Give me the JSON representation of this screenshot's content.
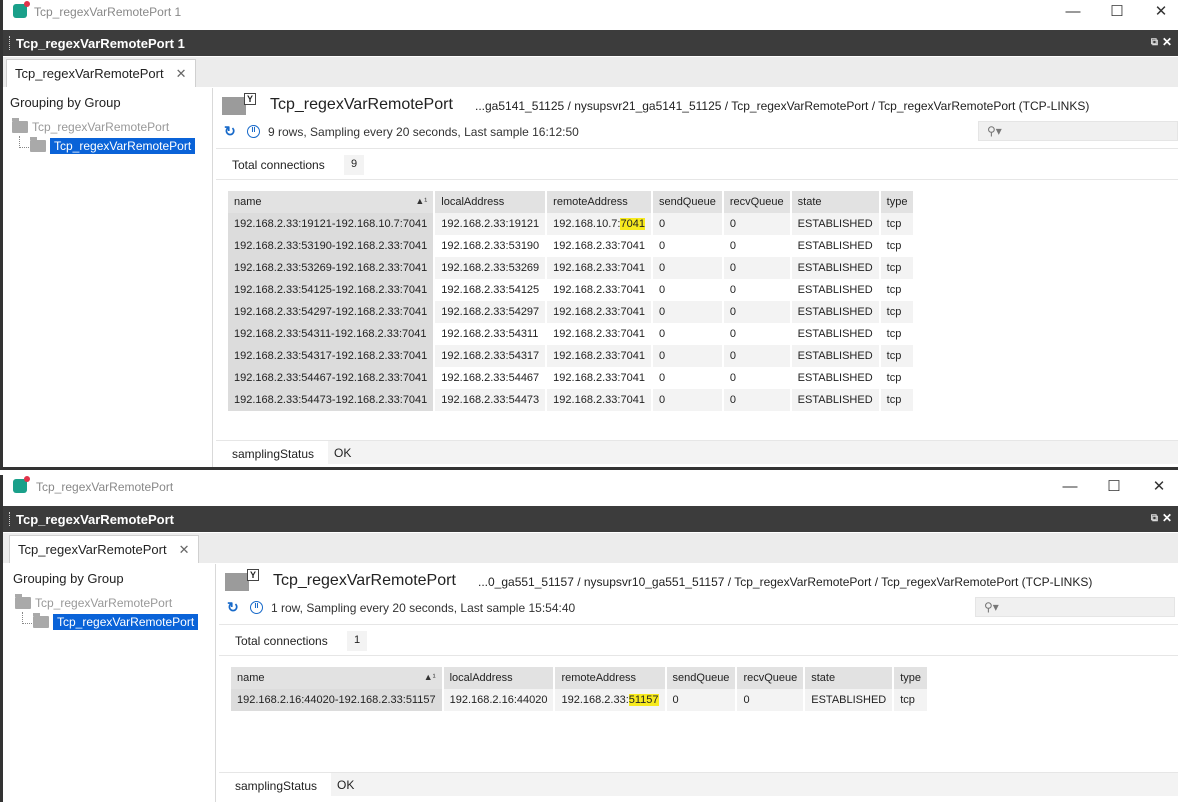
{
  "windows": [
    {
      "os_title": "Tcp_regexVarRemotePort 1",
      "dark_title": "Tcp_regexVarRemotePort 1",
      "tab_label": "Tcp_regexVarRemotePort",
      "tab_close": "✕",
      "grouping_label": "Grouping by Group",
      "tree_root": "Tcp_regexVarRemotePort",
      "tree_child": "Tcp_regexVarRemotePort",
      "header_title": "Tcp_regexVarRemotePort",
      "header_path": "...ga5141_51125 / nysupsvr21_ga5141_51125 / Tcp_regexVarRemotePort / Tcp_regexVarRemotePort (TCP-LINKS)",
      "status": "9 rows, Sampling every 20 seconds, Last sample 16:12:50",
      "total_label": "Total connections",
      "total_value": "9",
      "columns": [
        "name",
        "localAddress",
        "remoteAddress",
        "sendQueue",
        "recvQueue",
        "state",
        "type"
      ],
      "rows": [
        {
          "name": "192.168.2.33:19121-192.168.10.7:7041",
          "localAddress": "192.168.2.33:19121",
          "remote_prefix": "192.168.10.7:",
          "remote_port": "7041",
          "highlight": true,
          "sendQueue": "0",
          "recvQueue": "0",
          "state": "ESTABLISHED",
          "type": "tcp"
        },
        {
          "name": "192.168.2.33:53190-192.168.2.33:7041",
          "localAddress": "192.168.2.33:53190",
          "remote_prefix": "192.168.2.33:",
          "remote_port": "7041",
          "highlight": false,
          "sendQueue": "0",
          "recvQueue": "0",
          "state": "ESTABLISHED",
          "type": "tcp"
        },
        {
          "name": "192.168.2.33:53269-192.168.2.33:7041",
          "localAddress": "192.168.2.33:53269",
          "remote_prefix": "192.168.2.33:",
          "remote_port": "7041",
          "highlight": false,
          "sendQueue": "0",
          "recvQueue": "0",
          "state": "ESTABLISHED",
          "type": "tcp"
        },
        {
          "name": "192.168.2.33:54125-192.168.2.33:7041",
          "localAddress": "192.168.2.33:54125",
          "remote_prefix": "192.168.2.33:",
          "remote_port": "7041",
          "highlight": false,
          "sendQueue": "0",
          "recvQueue": "0",
          "state": "ESTABLISHED",
          "type": "tcp"
        },
        {
          "name": "192.168.2.33:54297-192.168.2.33:7041",
          "localAddress": "192.168.2.33:54297",
          "remote_prefix": "192.168.2.33:",
          "remote_port": "7041",
          "highlight": false,
          "sendQueue": "0",
          "recvQueue": "0",
          "state": "ESTABLISHED",
          "type": "tcp"
        },
        {
          "name": "192.168.2.33:54311-192.168.2.33:7041",
          "localAddress": "192.168.2.33:54311",
          "remote_prefix": "192.168.2.33:",
          "remote_port": "7041",
          "highlight": false,
          "sendQueue": "0",
          "recvQueue": "0",
          "state": "ESTABLISHED",
          "type": "tcp"
        },
        {
          "name": "192.168.2.33:54317-192.168.2.33:7041",
          "localAddress": "192.168.2.33:54317",
          "remote_prefix": "192.168.2.33:",
          "remote_port": "7041",
          "highlight": false,
          "sendQueue": "0",
          "recvQueue": "0",
          "state": "ESTABLISHED",
          "type": "tcp"
        },
        {
          "name": "192.168.2.33:54467-192.168.2.33:7041",
          "localAddress": "192.168.2.33:54467",
          "remote_prefix": "192.168.2.33:",
          "remote_port": "7041",
          "highlight": false,
          "sendQueue": "0",
          "recvQueue": "0",
          "state": "ESTABLISHED",
          "type": "tcp"
        },
        {
          "name": "192.168.2.33:54473-192.168.2.33:7041",
          "localAddress": "192.168.2.33:54473",
          "remote_prefix": "192.168.2.33:",
          "remote_port": "7041",
          "highlight": false,
          "sendQueue": "0",
          "recvQueue": "0",
          "state": "ESTABLISHED",
          "type": "tcp"
        }
      ],
      "sampling_label": "samplingStatus",
      "sampling_value": "OK"
    },
    {
      "os_title": "Tcp_regexVarRemotePort",
      "dark_title": "Tcp_regexVarRemotePort",
      "tab_label": "Tcp_regexVarRemotePort",
      "tab_close": "✕",
      "grouping_label": "Grouping by Group",
      "tree_root": "Tcp_regexVarRemotePort",
      "tree_child": "Tcp_regexVarRemotePort",
      "header_title": "Tcp_regexVarRemotePort",
      "header_path": "...0_ga551_51157 / nysupsvr10_ga551_51157 / Tcp_regexVarRemotePort / Tcp_regexVarRemotePort (TCP-LINKS)",
      "status": "1 row, Sampling every 20 seconds, Last sample 15:54:40",
      "total_label": "Total connections",
      "total_value": "1",
      "columns": [
        "name",
        "localAddress",
        "remoteAddress",
        "sendQueue",
        "recvQueue",
        "state",
        "type"
      ],
      "rows": [
        {
          "name": "192.168.2.16:44020-192.168.2.33:51157",
          "localAddress": "192.168.2.16:44020",
          "remote_prefix": "192.168.2.33:",
          "remote_port": "51157",
          "highlight": true,
          "sendQueue": "0",
          "recvQueue": "0",
          "state": "ESTABLISHED",
          "type": "tcp"
        }
      ],
      "sampling_label": "samplingStatus",
      "sampling_value": "OK"
    }
  ],
  "os_buttons": {
    "minimize": "—",
    "maximize": "☐",
    "close": "✕"
  },
  "panel_buttons": {
    "maximize": "⧉",
    "close": "✕"
  },
  "icons": {
    "app": "app-icon",
    "refresh": "refresh-icon",
    "pause": "pause-icon",
    "search": "search-icon",
    "filter": "filter-icon",
    "folder": "folder-icon",
    "sort": "sort-asc-icon"
  },
  "sort_indicator": "▲¹",
  "colors": {
    "selection": "#0a63d8",
    "highlight": "#f7ea1e",
    "dark_bar": "#3c3c3c",
    "icon_blue": "#1769c9"
  }
}
